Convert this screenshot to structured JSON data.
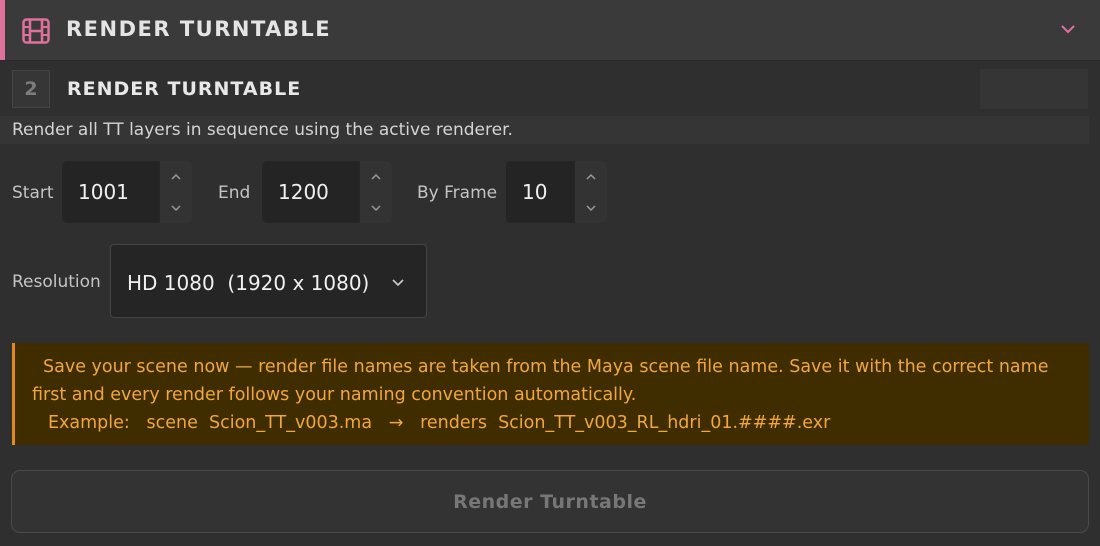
{
  "header": {
    "title": "RENDER TURNTABLE",
    "icon": "film-icon",
    "accent": "#e0709c"
  },
  "step": {
    "number": "2",
    "title": "RENDER TURNTABLE",
    "description": "Render all TT layers in sequence using the active renderer."
  },
  "frames": {
    "start_label": "Start",
    "start_value": "1001",
    "end_label": "End",
    "end_value": "1200",
    "by_label": "By Frame",
    "by_value": "10"
  },
  "resolution": {
    "label": "Resolution",
    "value": "HD 1080  (1920 x 1080)"
  },
  "warning": {
    "line1": "Save your scene now — render file names are taken from the Maya scene file name. Save it with the correct name",
    "line2": "first and every render follows your naming convention automatically.",
    "line3": "Example:   scene  Scion_TT_v003.ma   →   renders  Scion_TT_v003_RL_hdri_01.####.exr",
    "color": "#f1a640",
    "background": "#3f2d00"
  },
  "render_button": {
    "label": "Render Turntable"
  }
}
